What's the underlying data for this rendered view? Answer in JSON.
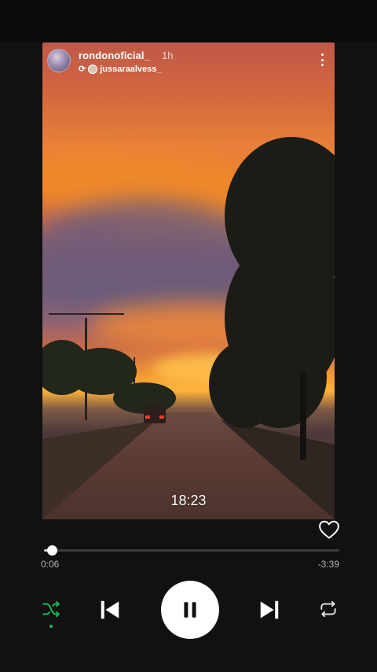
{
  "story": {
    "username": "rondonoficial_",
    "time_ago": "1h",
    "reposted_from": "jussaraalvess_",
    "timestamp": "18:23"
  },
  "player": {
    "elapsed": "0:06",
    "remaining": "-3:39",
    "progress_fraction": 0.027,
    "is_playing": true,
    "shuffle_enabled": true,
    "liked": false,
    "accent_color": "#1db954"
  },
  "icons": {
    "more": "more-vertical-icon",
    "repost": "repost-icon",
    "heart": "heart-outline-icon",
    "shuffle": "shuffle-icon",
    "previous": "skip-previous-icon",
    "pause": "pause-icon",
    "next": "skip-next-icon",
    "repeat": "repeat-icon"
  }
}
